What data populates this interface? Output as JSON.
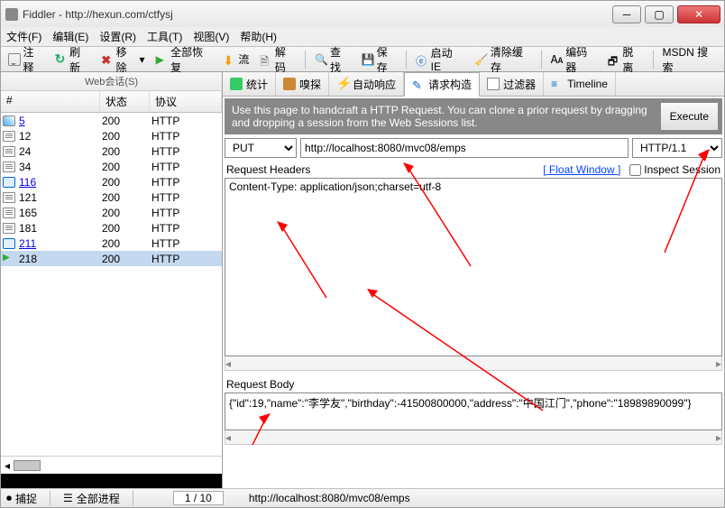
{
  "window": {
    "title": "Fiddler - http://hexun.com/ctfysj"
  },
  "menu": {
    "file": "文件(F)",
    "edit": "编辑(E)",
    "settings": "设置(R)",
    "tools": "工具(T)",
    "view": "视图(V)",
    "help": "帮助(H)"
  },
  "toolbar": {
    "comment": "注释",
    "replay": "刷新",
    "remove": "移除",
    "resume": "全部恢复",
    "stream": "流",
    "decode": "解码",
    "find": "查找",
    "save": "保存",
    "launch_ie": "启动 IE",
    "clear_cache": "清除缓存",
    "text_wizard": "编码器",
    "tearoff": "脱离",
    "msdn": "MSDN 搜索"
  },
  "sessions": {
    "title": "Web会话(S)",
    "col_num": "#",
    "col_status": "状态",
    "col_proto": "协议",
    "rows": [
      {
        "icon": "img",
        "num": "5",
        "status": "200",
        "proto": "HTTP",
        "link": true
      },
      {
        "icon": "text",
        "num": "12",
        "status": "200",
        "proto": "HTTP"
      },
      {
        "icon": "text",
        "num": "24",
        "status": "200",
        "proto": "HTTP"
      },
      {
        "icon": "text",
        "num": "34",
        "status": "200",
        "proto": "HTTP"
      },
      {
        "icon": "blue",
        "num": "116",
        "status": "200",
        "proto": "HTTP",
        "link": true
      },
      {
        "icon": "text",
        "num": "121",
        "status": "200",
        "proto": "HTTP"
      },
      {
        "icon": "text",
        "num": "165",
        "status": "200",
        "proto": "HTTP"
      },
      {
        "icon": "text",
        "num": "181",
        "status": "200",
        "proto": "HTTP"
      },
      {
        "icon": "blue",
        "num": "211",
        "status": "200",
        "proto": "HTTP",
        "link": true
      },
      {
        "icon": "play",
        "num": "218",
        "status": "200",
        "proto": "HTTP",
        "selected": true
      }
    ]
  },
  "tabs": {
    "statistics": "统计",
    "inspectors": "嗅探",
    "autoresponder": "自动响应",
    "composer": "请求构造",
    "filters": "过滤器",
    "timeline": "Timeline"
  },
  "composer": {
    "hint": "Use this page to handcraft a HTTP Request.  You can clone a prior request by dragging and dropping a session from the Web Sessions list.",
    "execute": "Execute",
    "method": "PUT",
    "url": "http://localhost:8080/mvc08/emps",
    "protocol": "HTTP/1.1",
    "headers_label": "Request Headers",
    "float_window": "[ Float Window ]",
    "inspect_session": "Inspect Session",
    "headers_value": "Content-Type: application/json;charset=utf-8",
    "body_label": "Request Body",
    "body_value": "{\"id\":19,\"name\":\"李学友\",\"birthday\":-41500800000,\"address\":\"中国江门\",\"phone\":\"18989890099\"}"
  },
  "status": {
    "capture": "捕捉",
    "all_process": "全部进程",
    "count": "1 / 10",
    "url": "http://localhost:8080/mvc08/emps"
  }
}
